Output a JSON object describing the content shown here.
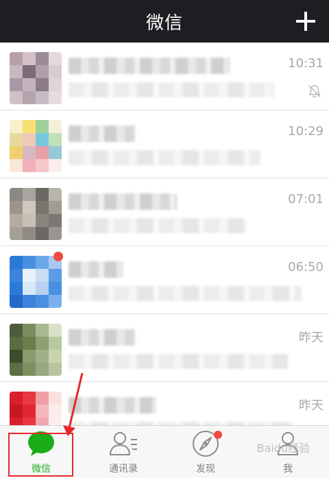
{
  "header": {
    "title": "微信"
  },
  "chats": [
    {
      "time": "10:31",
      "muted": true,
      "badge": false,
      "avatar_colors": [
        "#b8a0a8",
        "#d4c0c8",
        "#9c8c98",
        "#e6d8dc",
        "#c8b8c0",
        "#7c6c78",
        "#b0a0a8",
        "#d8ccd0",
        "#a898a4",
        "#c4b4bc",
        "#8c7c88",
        "#e0d4d8",
        "#d0c0c8",
        "#b4a4ac",
        "#c8bcc4",
        "#e8dce0"
      ]
    },
    {
      "time": "10:29",
      "muted": false,
      "badge": false,
      "avatar_colors": [
        "#f5f0c8",
        "#f8e070",
        "#9ed09a",
        "#f4f0d8",
        "#e8d8a0",
        "#f0c8b8",
        "#78c8e0",
        "#c0e0b8",
        "#f0d070",
        "#d8b8c0",
        "#e8a0a8",
        "#98c8d8",
        "#f8e8d8",
        "#f0b0b8",
        "#f4c8c8",
        "#fcecec"
      ]
    },
    {
      "time": "07:01",
      "muted": false,
      "badge": false,
      "avatar_colors": [
        "#8c8884",
        "#a8a4a0",
        "#6c6864",
        "#b8b4ac",
        "#9c948c",
        "#d0c8bc",
        "#787470",
        "#a09c94",
        "#b4aca0",
        "#c8c0b4",
        "#888480",
        "#7c7874",
        "#a4a098",
        "#908c84",
        "#6c6864",
        "#989490"
      ]
    },
    {
      "time": "06:50",
      "muted": false,
      "badge": true,
      "avatar_colors": [
        "#2c7ad8",
        "#4a90e0",
        "#6aa8e8",
        "#a8c8f0",
        "#3a84dc",
        "#e8f0fc",
        "#c8dcf4",
        "#5c9ce4",
        "#2c7ad8",
        "#d8e8f8",
        "#b8d0f0",
        "#4a90e0",
        "#2468c8",
        "#3a84dc",
        "#4a90e0",
        "#7cb0ec"
      ]
    },
    {
      "time": "昨天",
      "muted": false,
      "badge": false,
      "avatar_colors": [
        "#4c5c3c",
        "#7c8c5c",
        "#a8b890",
        "#d8e0c8",
        "#5c6c44",
        "#6c7c4c",
        "#8ca070",
        "#b8c8a0",
        "#3c4c2c",
        "#889c6c",
        "#a0b088",
        "#c8d4b0",
        "#5c7048",
        "#7c9060",
        "#98a880",
        "#b8c4a0"
      ]
    },
    {
      "time": "昨天",
      "muted": false,
      "badge": false,
      "avatar_colors": [
        "#d8202c",
        "#e83840",
        "#f0a0a4",
        "#fce0e0",
        "#c81824",
        "#e02830",
        "#f4b8bc",
        "#fcecec",
        "#d8202c",
        "#e83840",
        "#f0a8ac",
        "#fceeee",
        "#e04048",
        "#ec6068",
        "#f4c0c4",
        "#fcf4f4"
      ]
    }
  ],
  "tabs": [
    {
      "label": "微信",
      "active": true,
      "icon": "chat-bubble-icon"
    },
    {
      "label": "通讯录",
      "active": false,
      "icon": "contacts-icon"
    },
    {
      "label": "发现",
      "active": false,
      "icon": "compass-icon"
    },
    {
      "label": "我",
      "active": false,
      "icon": "person-icon"
    }
  ],
  "watermark": "Baidu经验",
  "colors": {
    "header_bg": "#1e1e22",
    "active_green": "#1aad19",
    "badge_red": "#f24a3e",
    "annotation_red": "#e8272b"
  }
}
